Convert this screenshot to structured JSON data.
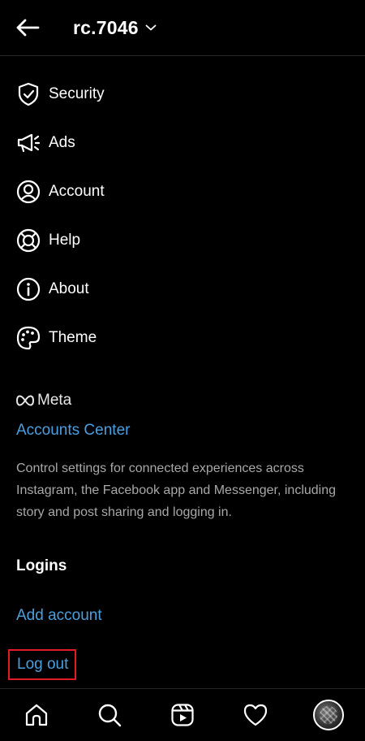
{
  "header": {
    "back_icon": "arrow-left-icon",
    "username": "rc.7046",
    "dropdown_icon": "chevron-down-icon"
  },
  "menu": {
    "items": [
      {
        "label": "Security",
        "icon": "shield-check-icon"
      },
      {
        "label": "Ads",
        "icon": "megaphone-icon"
      },
      {
        "label": "Account",
        "icon": "user-circle-icon"
      },
      {
        "label": "Help",
        "icon": "lifebuoy-icon"
      },
      {
        "label": "About",
        "icon": "info-circle-icon"
      },
      {
        "label": "Theme",
        "icon": "palette-icon"
      }
    ]
  },
  "meta_section": {
    "logo_text": "Meta",
    "accounts_center_label": "Accounts Center",
    "description": "Control settings for connected experiences across Instagram, the Facebook app and Messenger, including story and post sharing and logging in."
  },
  "logins": {
    "heading": "Logins",
    "add_account_label": "Add account",
    "logout_label": "Log out"
  },
  "bottom_nav": {
    "items": [
      "home-icon",
      "search-icon",
      "reels-icon",
      "heart-icon",
      "profile-avatar"
    ]
  },
  "colors": {
    "background": "#000000",
    "text": "#ffffff",
    "link": "#4a9fdf",
    "secondary_text": "#a8a8a8",
    "highlight_border": "#e01b24"
  }
}
